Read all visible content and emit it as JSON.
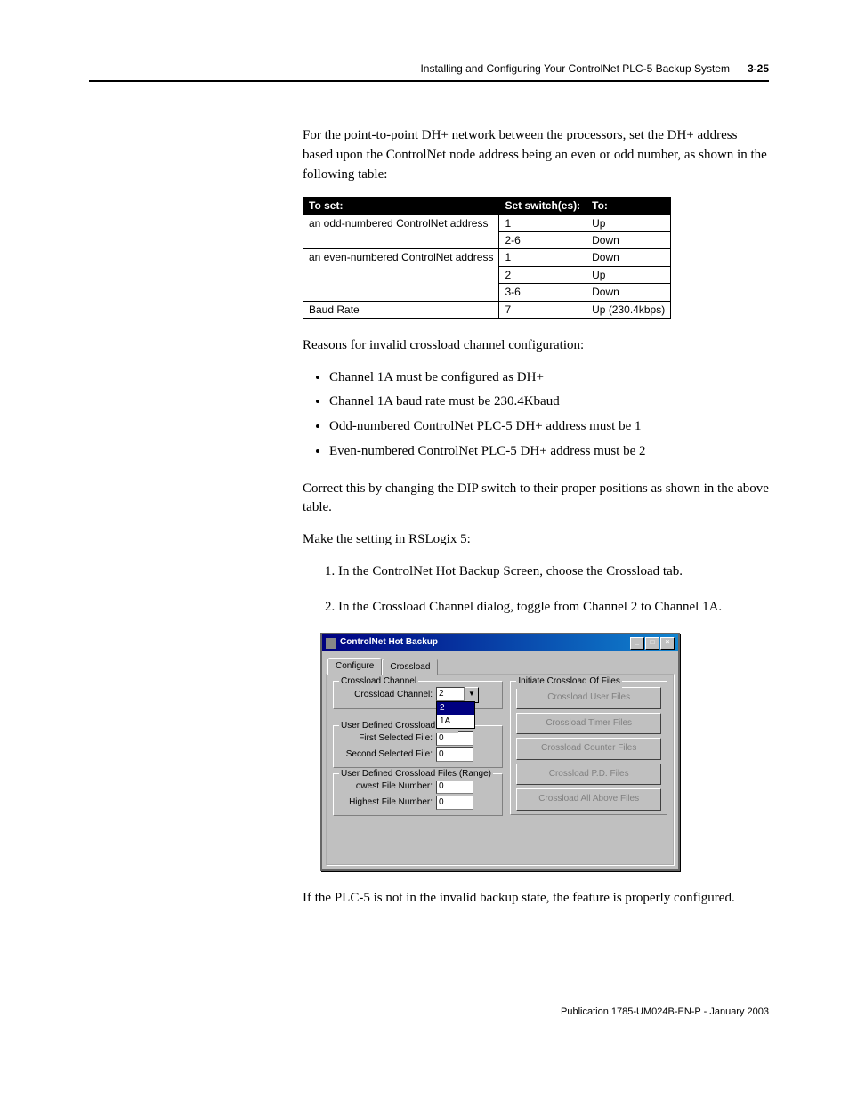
{
  "header": {
    "title": "Installing and Configuring Your ControlNet PLC-5 Backup System",
    "page": "3-25"
  },
  "intro": "For the point-to-point DH+ network between the processors, set the DH+ address based upon the ControlNet node address being an even or odd number, as shown in the following table:",
  "table": {
    "headers": [
      "To set:",
      "Set switch(es):",
      "To:"
    ],
    "rows": [
      {
        "toset": "an odd-numbered ControlNet address",
        "switches": "1",
        "to": "Up"
      },
      {
        "toset": "",
        "switches": "2-6",
        "to": "Down"
      },
      {
        "toset": "an even-numbered ControlNet address",
        "switches": "1",
        "to": "Down"
      },
      {
        "toset": "",
        "switches": "2",
        "to": "Up"
      },
      {
        "toset": "",
        "switches": "3-6",
        "to": "Down"
      },
      {
        "toset": "Baud Rate",
        "switches": "7",
        "to": "Up (230.4kbps)"
      }
    ]
  },
  "reasons_heading": "Reasons for invalid crossload channel configuration:",
  "reasons": [
    "Channel 1A must be configured as DH+",
    "Channel 1A baud rate must be 230.4Kbaud",
    "Odd-numbered ControlNet PLC-5 DH+ address must be 1",
    "Even-numbered ControlNet PLC-5 DH+ address must be 2"
  ],
  "correction": "Correct this by changing the DIP switch to their proper positions as shown in the above table.",
  "make_setting": "Make the setting in RSLogix 5:",
  "steps": [
    "In the ControlNet Hot Backup Screen, choose the Crossload tab.",
    "In the Crossload Channel dialog, toggle from Channel 2 to Channel 1A."
  ],
  "dialog": {
    "title": "ControlNet Hot Backup",
    "tabs": {
      "configure": "Configure",
      "crossload": "Crossload"
    },
    "groups": {
      "crossload_channel": {
        "legend": "Crossload Channel",
        "field": "Crossload Channel:",
        "value": "2",
        "options": [
          "2",
          "1A"
        ]
      },
      "user_files": {
        "legend": "User Defined Crossload Files",
        "first": "First Selected File:",
        "first_val": "0",
        "second": "Second Selected File:",
        "second_val": "0"
      },
      "user_range": {
        "legend": "User Defined Crossload Files (Range)",
        "low": "Lowest File Number:",
        "low_val": "0",
        "high": "Highest File Number:",
        "high_val": "0"
      },
      "initiate": {
        "legend": "Initiate Crossload Of Files",
        "buttons": [
          "Crossload User Files",
          "Crossload Timer Files",
          "Crossload Counter Files",
          "Crossload P.D. Files",
          "Crossload All Above Files"
        ]
      }
    }
  },
  "closing": "If the PLC-5 is not in the invalid backup state, the feature is properly configured.",
  "publication": "Publication 1785-UM024B-EN-P - January 2003"
}
